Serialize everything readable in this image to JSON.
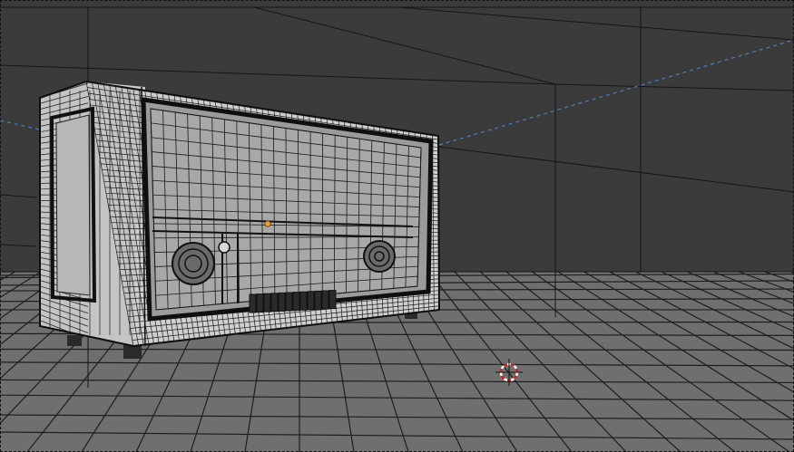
{
  "viewport": {
    "shading": "wireframe-overlay",
    "colors": {
      "background": "#3a3a3a",
      "floor": "#707070",
      "floor_lines": "#1e1e1e",
      "wall_lines": "#1a1a1a",
      "object_body": "#c9c9c9",
      "object_wire": "#1c1c1c",
      "camera_line": "#4a7ec0",
      "origin_dot": "#f0a030",
      "cursor_red": "#d02020",
      "cursor_white": "#ffffff"
    }
  },
  "scene": {
    "object": "radio-mesh",
    "cursor": "3d-cursor",
    "floor": "floor-plane-grid"
  }
}
